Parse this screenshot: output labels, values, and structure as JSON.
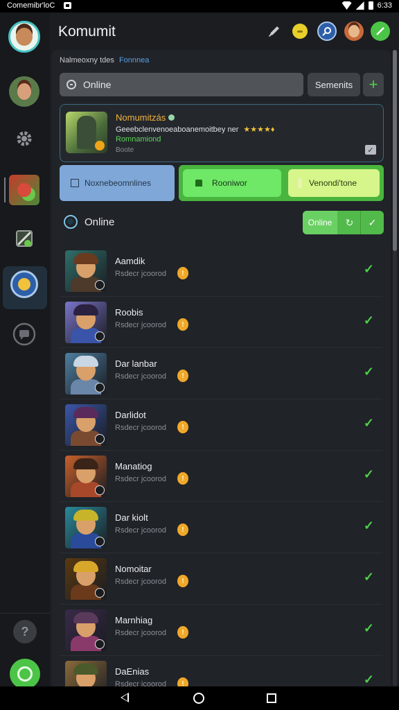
{
  "status_bar": {
    "carrier": "Comemibr'loC",
    "time": "6:33"
  },
  "app": {
    "title": "Komumit"
  },
  "breadcrumb": {
    "text": "Nalmeoxny tdes",
    "link": "Fonnnea"
  },
  "status_field": {
    "value": "Online"
  },
  "toolbar": {
    "search_label": "Semenits",
    "add_label": "+"
  },
  "featured": {
    "title": "Nomumitzás",
    "description": "Geeebclenvenoeaboanemoitbey ner",
    "stars": "★★★★♦",
    "green_text": "Romnamiond",
    "subtext": "Boote"
  },
  "tabs": [
    {
      "label": "Noxnebeomnlines"
    },
    {
      "label": "Rooniwor"
    },
    {
      "label": "Venondi'tone"
    }
  ],
  "online_section": {
    "title": "Online",
    "button_label": "Online",
    "refresh_glyph": "↻",
    "confirm_glyph": "✓"
  },
  "members": [
    {
      "name": "Aamdik",
      "sub": "Rsdecr jcoorod",
      "coin": "!",
      "hair": "#6a3b1f",
      "body": "#4d3a2a",
      "bg": "#2f6f6a"
    },
    {
      "name": "Roobis",
      "sub": "Rsdecr jcoorod",
      "coin": "!",
      "hair": "#2b2140",
      "body": "#3954a8",
      "bg": "#7a74c8"
    },
    {
      "name": "Dar lanbar",
      "sub": "Rsdecr jcoorod",
      "coin": "!",
      "hair": "#c9d6e4",
      "body": "#6a86a8",
      "bg": "#4e7fa0"
    },
    {
      "name": "Darlidot",
      "sub": "Rsdecr jcoorod",
      "coin": "!",
      "hair": "#5a2a5a",
      "body": "#7a4a30",
      "bg": "#3a56a8"
    },
    {
      "name": "Manatiog",
      "sub": "Rsdecr jcoorod",
      "coin": "!",
      "hair": "#3a2418",
      "body": "#a8482a",
      "bg": "#c8602a"
    },
    {
      "name": "Dar kiolt",
      "sub": "Rsdecr jcoorod",
      "coin": "!",
      "hair": "#c8b42a",
      "body": "#2a4a9a",
      "bg": "#2a8a9a"
    },
    {
      "name": "Nomoitar",
      "sub": "Rsdecr jcoorod",
      "coin": "!",
      "hair": "#d8a82a",
      "body": "#6a3a1a",
      "bg": "#5a3a10"
    },
    {
      "name": "Marnhiag",
      "sub": "Rsdecr jcoorod",
      "coin": "!",
      "hair": "#5a3a5a",
      "body": "#8a3a6a",
      "bg": "#3a2a4a"
    },
    {
      "name": "DaEnias",
      "sub": "Rsdecr jcoorod",
      "coin": "!",
      "hair": "#4a5a2a",
      "body": "#7a5a2a",
      "bg": "#8a6a3a"
    }
  ],
  "colors": {
    "accent_green": "#4ed24a",
    "accent_blue": "#5aa0e6",
    "coin": "#f0a82a"
  }
}
